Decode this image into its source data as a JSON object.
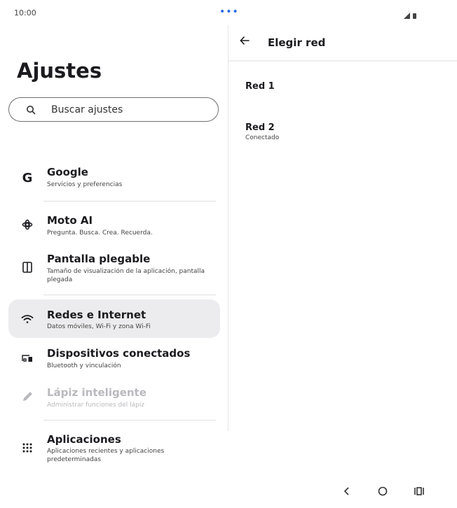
{
  "status": {
    "time": "10:00",
    "dots": "•••"
  },
  "settings": {
    "title": "Ajustes",
    "search_placeholder": "Buscar ajustes",
    "items": [
      {
        "title": "Google",
        "subtitle": "Servicios y preferencias",
        "icon": "google-icon"
      },
      {
        "title": "Moto AI",
        "subtitle": "Pregunta. Busca. Crea. Recuerda.",
        "icon": "moto-ai-icon"
      },
      {
        "title": "Pantalla plegable",
        "subtitle": "Tamaño de visualización de la aplicación, pantalla plegada",
        "icon": "foldable-icon"
      },
      {
        "title": "Redes e Internet",
        "subtitle": "Datos móviles, Wi-Fi y zona Wi-Fi",
        "icon": "wifi-icon"
      },
      {
        "title": "Dispositivos conectados",
        "subtitle": "Bluetooth y vinculación",
        "icon": "devices-icon"
      },
      {
        "title": "Lápiz inteligente",
        "subtitle": "Administrar funciones del lápiz",
        "icon": "pen-icon"
      },
      {
        "title": "Aplicaciones",
        "subtitle": "Aplicaciones recientes y aplicaciones predeterminadas",
        "icon": "apps-grid-icon"
      }
    ]
  },
  "detail": {
    "title": "Elegir red",
    "networks": [
      {
        "name": "Red 1",
        "status": ""
      },
      {
        "name": "Red 2",
        "status": "Conectado"
      }
    ]
  },
  "colors": {
    "selected_bg": "#ececee",
    "accent_dots": "#2a6be0",
    "disabled_text": "#b9b9bd"
  }
}
